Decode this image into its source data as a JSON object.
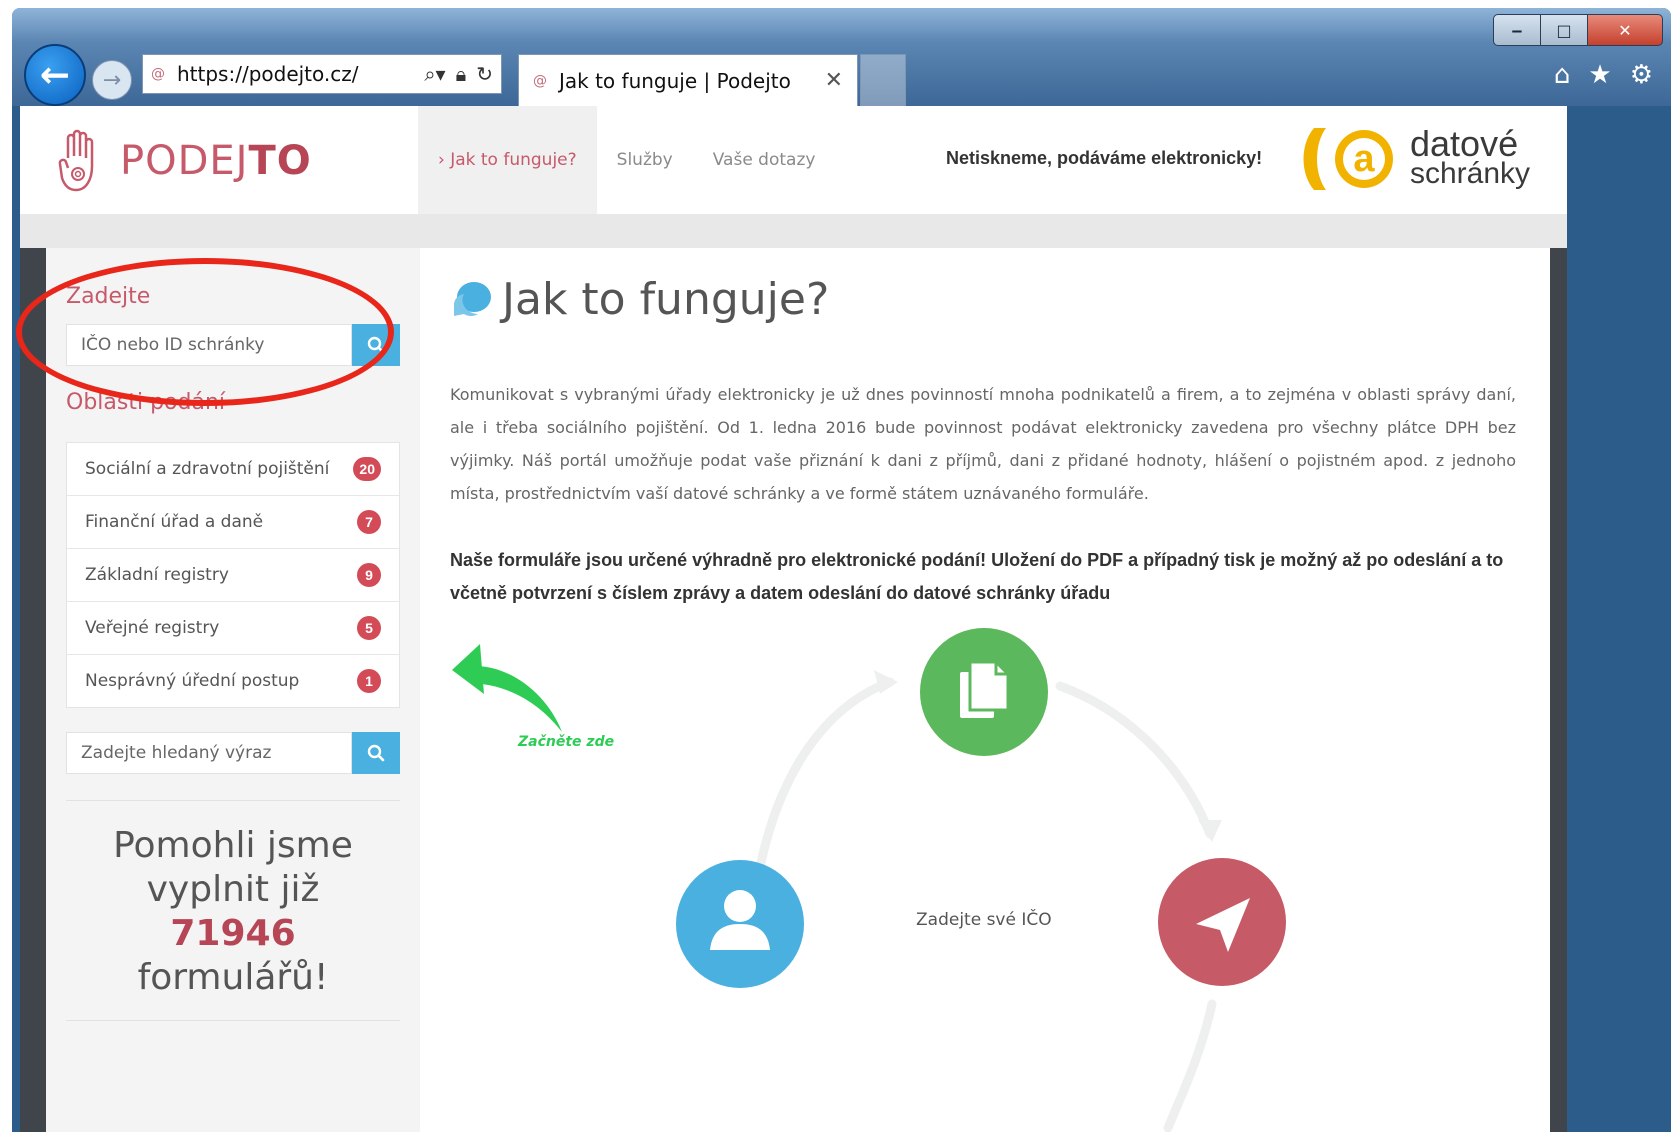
{
  "browser": {
    "url": "https://podejto.cz/",
    "tab_title": "Jak to funguje | Podejto",
    "window_controls": [
      "minimize-icon",
      "maximize-icon",
      "close-icon"
    ],
    "toolbar_icons": [
      "home-icon",
      "star-icon",
      "gear-icon"
    ]
  },
  "site": {
    "logo_light": "PODEJ",
    "logo_bold": "TO",
    "nav": [
      {
        "label": "› Jak to funguje?",
        "active": true
      },
      {
        "label": "Služby",
        "active": false
      },
      {
        "label": "Vaše dotazy",
        "active": false
      }
    ],
    "slogan": "Netiskneme, podáváme elektronicky!",
    "ds_logo_line1": "datové",
    "ds_logo_line2": "schránky"
  },
  "sidebar": {
    "title_enter": "Zadejte",
    "ico_placeholder": "IČO nebo ID schránky",
    "title_areas": "Oblasti podání",
    "categories": [
      {
        "label": "Sociální a zdravotní pojištění",
        "count": "20"
      },
      {
        "label": "Finanční úřad a daně",
        "count": "7"
      },
      {
        "label": "Základní registry",
        "count": "9"
      },
      {
        "label": "Veřejné registry",
        "count": "5"
      },
      {
        "label": "Nesprávný úřední postup",
        "count": "1"
      }
    ],
    "search_placeholder": "Zadejte hledaný výraz",
    "counter_line1": "Pomohli jsme",
    "counter_line2": "vyplnit již",
    "counter_number": "71946",
    "counter_line3": "formulářů!"
  },
  "main": {
    "title": "Jak to funguje?",
    "paragraph": "Komunikovat s vybranými úřady elektronicky je už dnes povinností mnoha podnikatelů a firem, a to zejména v oblasti správy daní, ale i třeba sociálního pojištění. Od 1. ledna 2016 bude povinnost podávat elektronicky zavedena pro všechny plátce DPH bez výjimky. Náš portál umožňuje podat vaše přiznání k dani z příjmů, dani z přidané hodnoty, hlášení o pojistném apod. z jednoho místa, prostřednictvím vaší datové schránky a ve formě státem uznávaného formuláře.",
    "bold_note": "Naše formuláře jsou určené výhradně pro elektronické podání! Uložení do PDF a případný tisk je možný až po odeslání a to včetně potvrzení s číslem zprávy a datem odeslání do datové schránky úřadu",
    "start_here": "Začněte zde",
    "step_label": "Zadejte své IČO"
  },
  "colors": {
    "brand": "#c6596a",
    "accent_blue": "#4ab0e0",
    "badge": "#d24b57",
    "step_green": "#5cb85c",
    "step_red": "#c75a67",
    "annotation_red": "#e8261a"
  }
}
